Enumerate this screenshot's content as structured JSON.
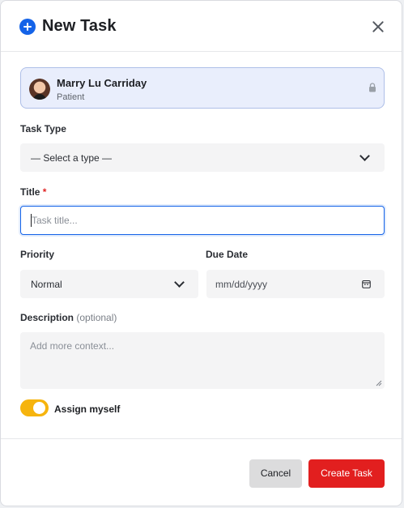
{
  "modal": {
    "title": "New Task",
    "icons": {
      "header": "plus-circle-icon",
      "close": "close-icon",
      "lock": "lock-icon",
      "chevron": "chevron-down-icon",
      "calendar": "calendar-icon"
    }
  },
  "patient": {
    "name": "Marry Lu Carriday",
    "role": "Patient"
  },
  "task_type": {
    "label": "Task Type",
    "selected": "— Select a type —"
  },
  "title_field": {
    "label": "Title",
    "required_mark": "*",
    "placeholder": "Task title..."
  },
  "priority": {
    "label": "Priority",
    "selected": "Normal"
  },
  "due_date": {
    "label": "Due Date",
    "placeholder": "mm/dd/yyyy"
  },
  "description": {
    "label": "Description",
    "optional_note": "(optional)",
    "placeholder": "Add more context..."
  },
  "assign": {
    "label": "Assign myself",
    "enabled": true
  },
  "footer": {
    "cancel_label": "Cancel",
    "create_label": "Create Task"
  },
  "colors": {
    "accent": "#1463e8",
    "primary_action": "#e21f1f",
    "toggle_on": "#f6b40e",
    "patient_card_bg": "#e9eefc"
  }
}
